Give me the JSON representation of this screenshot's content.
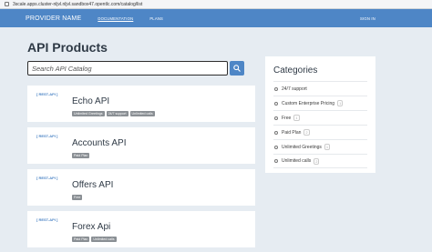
{
  "browser": {
    "url": "3scale.apps.cluster-nljvl.nljvl.sandbox47.opentlc.com/catalog/list"
  },
  "nav": {
    "brand": "PROVIDER NAME",
    "links": [
      "DOCUMENTATION",
      "PLANS"
    ],
    "signin": "SIGN IN"
  },
  "page": {
    "title": "API Products"
  },
  "search": {
    "placeholder": "Search API Catalog"
  },
  "apis": [
    {
      "badge": "[ REST-API ]",
      "name": "Echo API",
      "tags": [
        "Unlimited Greetings",
        "24/7 support",
        "Unlimited calls"
      ]
    },
    {
      "badge": "[ REST-API ]",
      "name": "Accounts API",
      "tags": [
        "Paid Plan"
      ]
    },
    {
      "badge": "[ REST-API ]",
      "name": "Offers API",
      "tags": [
        "Free"
      ]
    },
    {
      "badge": "[ REST-API ]",
      "name": "Forex Api",
      "tags": [
        "Paid Plan",
        "Unlimited calls"
      ]
    }
  ],
  "categories": {
    "title": "Categories",
    "items": [
      {
        "label": "24/7 support",
        "count": ""
      },
      {
        "label": "Custom Enterprise Pricing",
        "count": "1"
      },
      {
        "label": "Free",
        "count": "1"
      },
      {
        "label": "Paid Plan",
        "count": "2"
      },
      {
        "label": "Unlimited Greetings",
        "count": "1"
      },
      {
        "label": "Unlimited calls",
        "count": "2"
      }
    ]
  },
  "colors": {
    "nav": "#4e86c6",
    "background": "#e6ecf2",
    "tag": "#8a8f94"
  },
  "icons": {
    "search": "search-icon",
    "lock": "lock-icon"
  }
}
